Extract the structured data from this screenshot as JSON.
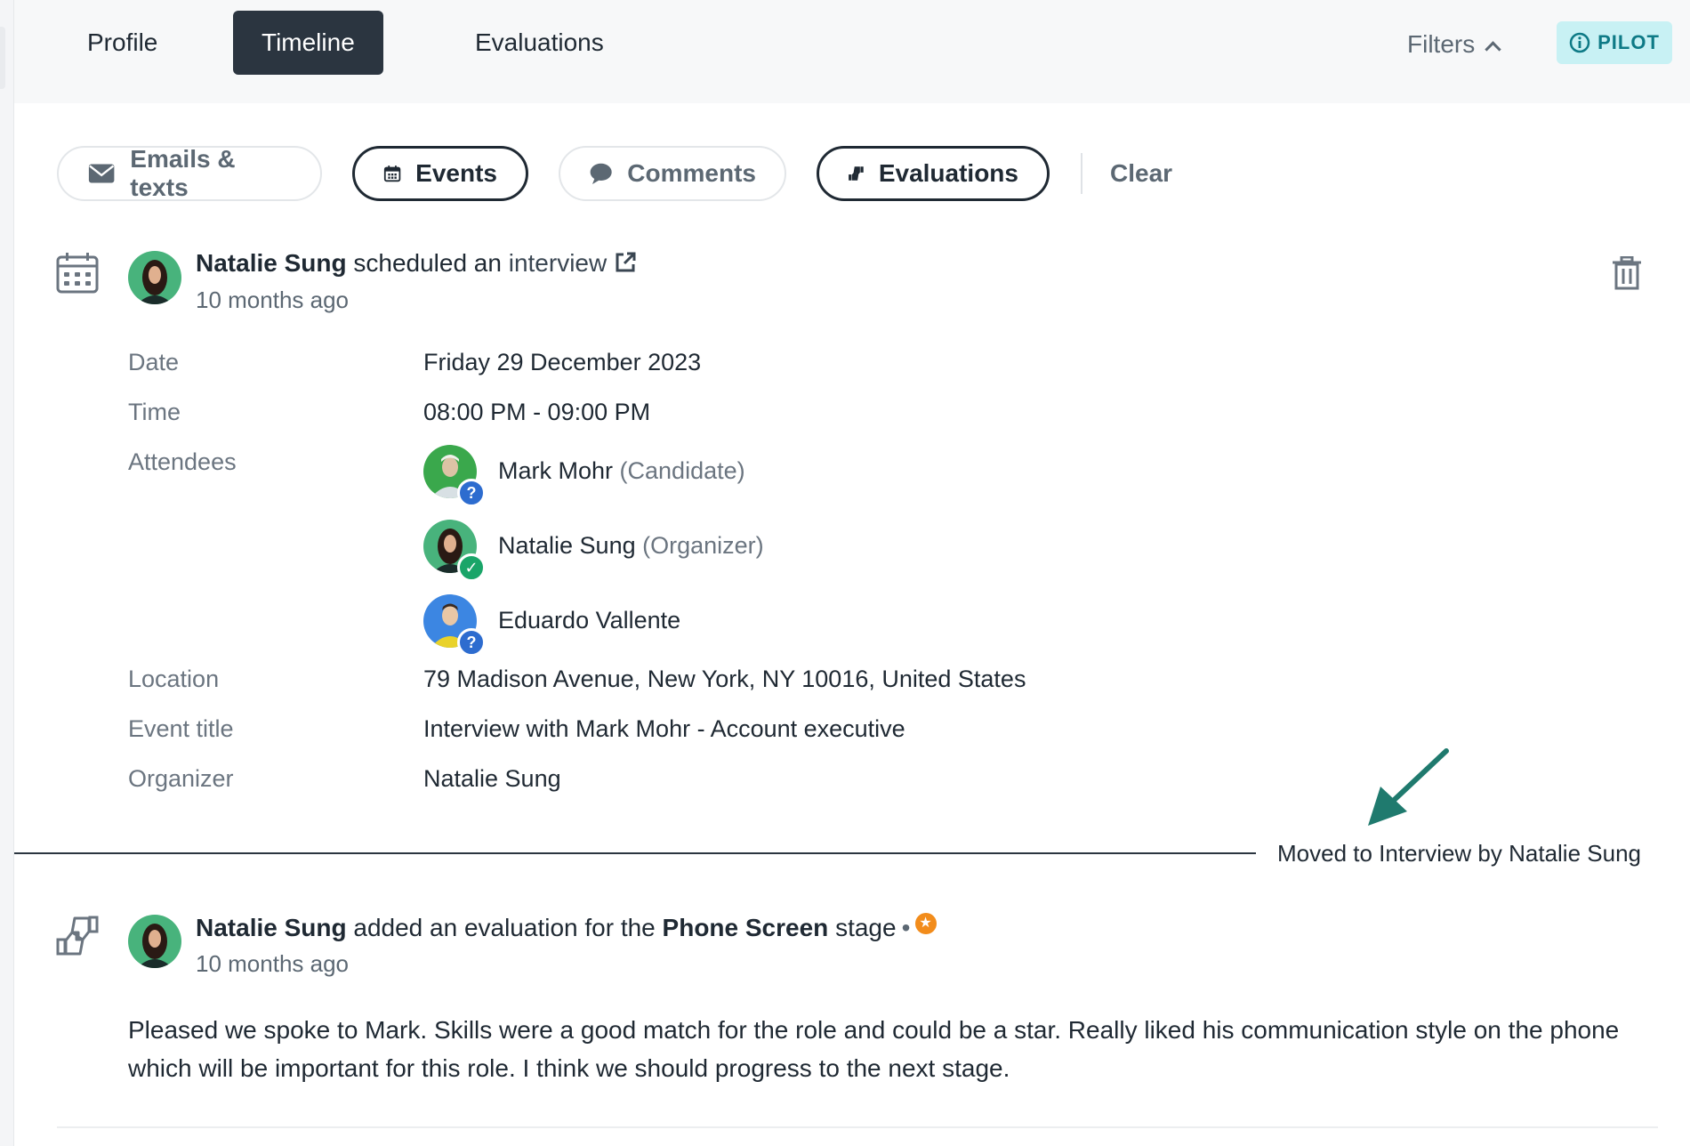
{
  "tabs": [
    {
      "label": "Profile",
      "active": false
    },
    {
      "label": "Timeline",
      "active": true
    },
    {
      "label": "Evaluations",
      "active": false
    }
  ],
  "header": {
    "filters_label": "Filters",
    "pilot_label": "PILOT"
  },
  "filter_chips": [
    {
      "label": "Emails & texts",
      "selected": false,
      "icon": "envelope-icon"
    },
    {
      "label": "Events",
      "selected": true,
      "icon": "calendar-icon"
    },
    {
      "label": "Comments",
      "selected": false,
      "icon": "comment-icon"
    },
    {
      "label": "Evaluations",
      "selected": true,
      "icon": "thumbs-icon"
    }
  ],
  "clear_label": "Clear",
  "event": {
    "actor": "Natalie Sung",
    "action": "scheduled an",
    "link": "interview",
    "time": "10 months ago",
    "details": [
      {
        "label": "Date",
        "value": "Friday 29 December 2023"
      },
      {
        "label": "Time",
        "value": "08:00 PM - 09:00 PM"
      },
      {
        "label": "Attendees",
        "value": ""
      },
      {
        "label": "Location",
        "value": "79 Madison Avenue, New York, NY 10016, United States"
      },
      {
        "label": "Event title",
        "value": "Interview with Mark Mohr - Account executive"
      },
      {
        "label": "Organizer",
        "value": "Natalie Sung"
      }
    ],
    "attendees": [
      {
        "name": "Mark Mohr",
        "role": "(Candidate)",
        "status": "?"
      },
      {
        "name": "Natalie Sung",
        "role": "(Organizer)",
        "status": "✓"
      },
      {
        "name": "Eduardo Vallente",
        "role": "",
        "status": "?"
      }
    ]
  },
  "stage_change": "Moved to Interview by Natalie Sung",
  "evaluation": {
    "actor": "Natalie Sung",
    "action": "added an evaluation for the",
    "stage": "Phone Screen",
    "suffix": "stage",
    "separator": "•",
    "time": "10 months ago",
    "text": "Pleased we spoke to Mark. Skills were a good match for the role and could be a star. Really liked his communication style on the phone which will be important for this role. I think we should progress to the next stage."
  },
  "colors": {
    "active_tab_bg": "#2b3540",
    "pilot_bg": "#c8f1f4",
    "pilot_text": "#0e7a86",
    "badge_unknown": "#2d6ccf",
    "badge_accepted": "#1aa569",
    "arrow": "#1f7a6e",
    "rating_star": "#f28c1b"
  }
}
